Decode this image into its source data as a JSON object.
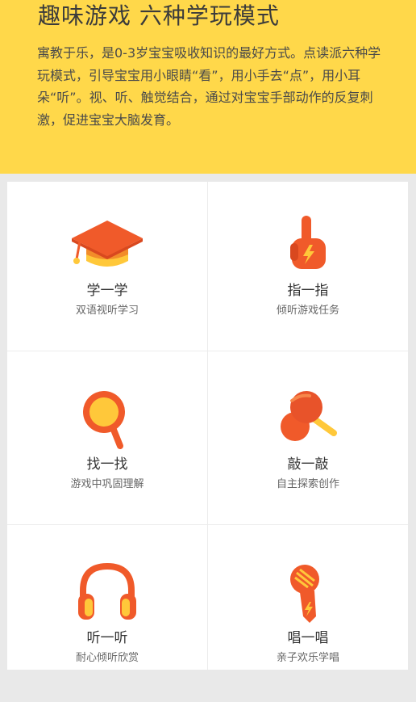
{
  "hero": {
    "title": "趣味游戏  六种学玩模式",
    "description": "寓教于乐，是0-3岁宝宝吸收知识的最好方式。点读派六种学玩模式，引导宝宝用小眼睛“看”，用小手去“点”，用小耳朵“听”。视、听、触觉结合，通过对宝宝手部动作的反复刺激，促进宝宝大脑发育。"
  },
  "modes": [
    {
      "title": "学一学",
      "subtitle": "双语视听学习",
      "icon": "graduation-cap-icon"
    },
    {
      "title": "指一指",
      "subtitle": "倾听游戏任务",
      "icon": "pointing-hand-icon"
    },
    {
      "title": "找一找",
      "subtitle": "游戏中巩固理解",
      "icon": "magnifier-icon"
    },
    {
      "title": "敲一敲",
      "subtitle": "自主探索创作",
      "icon": "maracas-icon"
    },
    {
      "title": "听一听",
      "subtitle": "耐心倾听欣赏",
      "icon": "headphones-icon"
    },
    {
      "title": "唱一唱",
      "subtitle": "亲子欢乐学唱",
      "icon": "microphone-icon"
    }
  ],
  "colors": {
    "hero_background": "#ffd84a",
    "icon_orange": "#f05a2a",
    "icon_yellow": "#ffc83a"
  }
}
